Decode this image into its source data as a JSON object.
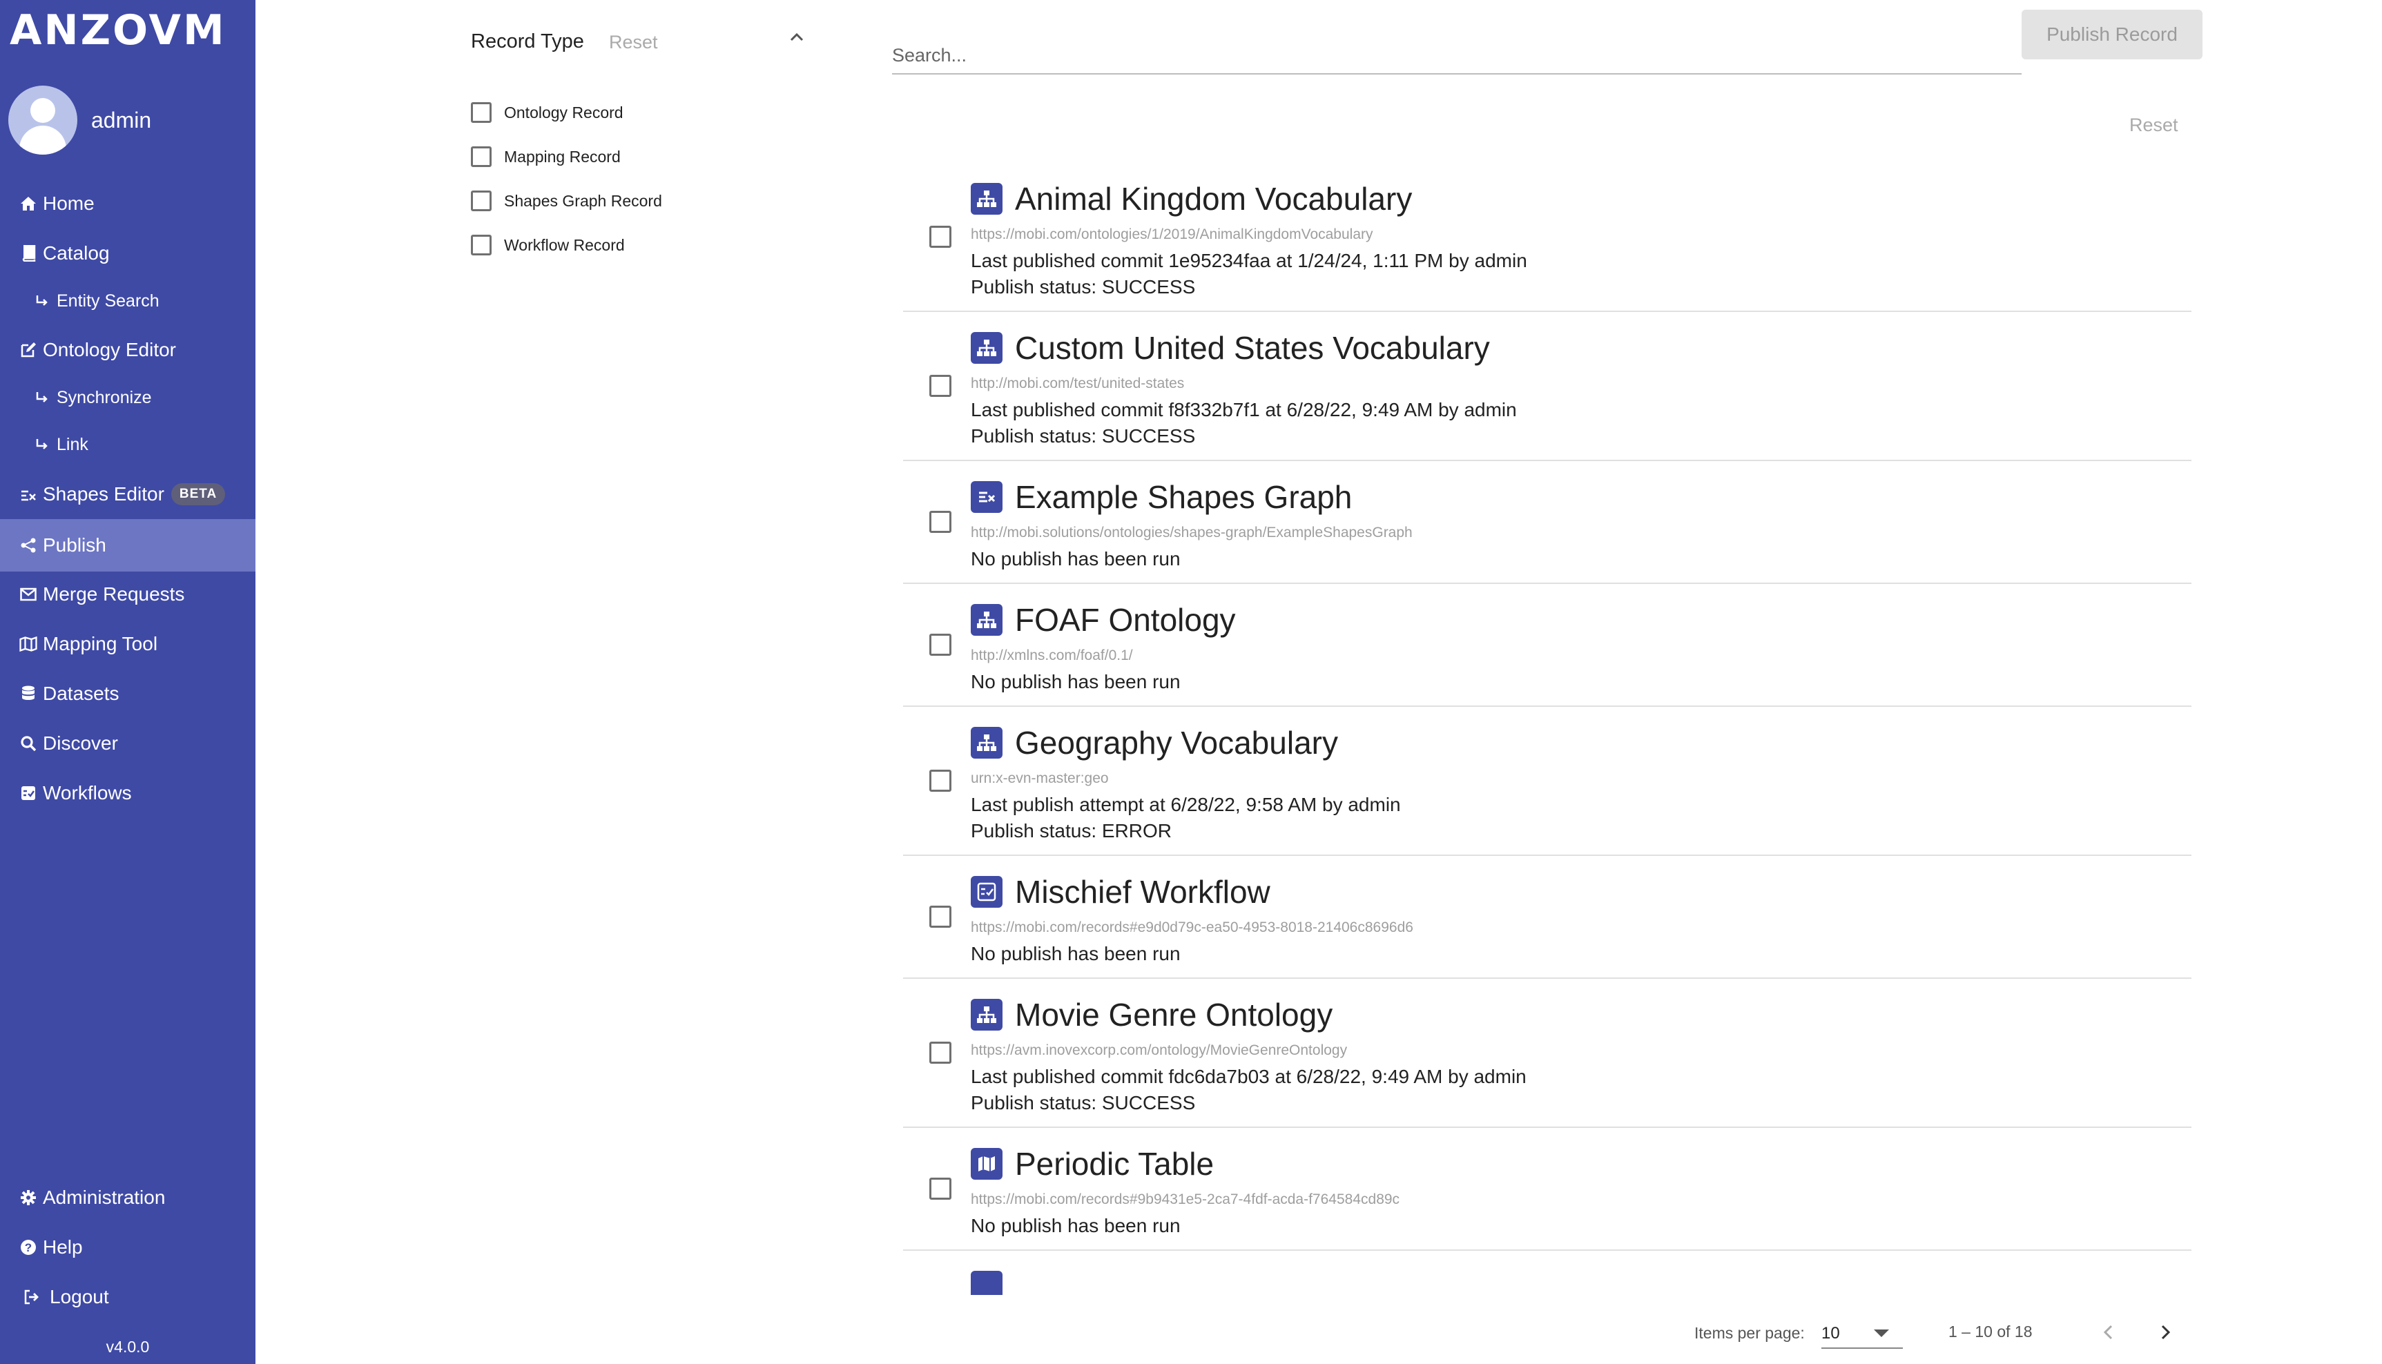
{
  "app": {
    "logo": "ANZOVM",
    "version": "v4.0.0"
  },
  "user": {
    "name": "admin"
  },
  "nav": {
    "home": "Home",
    "catalog": "Catalog",
    "entity_search": "Entity Search",
    "ontology_editor": "Ontology Editor",
    "synchronize": "Synchronize",
    "link": "Link",
    "shapes_editor": "Shapes Editor",
    "beta": "BETA",
    "publish": "Publish",
    "merge_requests": "Merge Requests",
    "mapping_tool": "Mapping Tool",
    "datasets": "Datasets",
    "discover": "Discover",
    "workflows": "Workflows",
    "administration": "Administration",
    "help": "Help",
    "logout": "Logout"
  },
  "filter": {
    "title": "Record Type",
    "reset": "Reset",
    "options": [
      "Ontology Record",
      "Mapping Record",
      "Shapes Graph Record",
      "Workflow Record"
    ]
  },
  "search": {
    "placeholder": "Search..."
  },
  "toolbar": {
    "publish_label": "Publish Record",
    "reset_label": "Reset"
  },
  "records": [
    {
      "title": "Animal Kingdom Vocabulary",
      "icon": "ontology-icon",
      "iri": "https://mobi.com/ontologies/1/2019/AnimalKingdomVocabulary",
      "line1_prefix": "Last published commit ",
      "line1_value": "1e95234faa",
      "line1_mid": " at 1/24/24, 1:11 PM by ",
      "line1_user": "admin",
      "status": "Publish status: SUCCESS"
    },
    {
      "title": "Custom United States Vocabulary",
      "icon": "ontology-icon",
      "iri": "http://mobi.com/test/united-states",
      "line1_prefix": "Last published commit ",
      "line1_value": "f8f332b7f1",
      "line1_mid": " at 6/28/22, 9:49 AM by ",
      "line1_user": "admin",
      "status": "Publish status: SUCCESS"
    },
    {
      "title": "Example Shapes Graph",
      "icon": "shapes-graph-icon",
      "iri": "http://mobi.solutions/ontologies/shapes-graph/ExampleShapesGraph",
      "line1": "No publish has been run"
    },
    {
      "title": "FOAF Ontology",
      "icon": "ontology-icon",
      "iri": "http://xmlns.com/foaf/0.1/",
      "line1": "No publish has been run"
    },
    {
      "title": "Geography Vocabulary",
      "icon": "ontology-icon",
      "iri": "urn:x-evn-master:geo",
      "line1_prefix": "Last publish attempt at 6/28/22, 9:58 AM by ",
      "line1_user": "admin",
      "status": "Publish status: ERROR"
    },
    {
      "title": "Mischief Workflow",
      "icon": "workflow-icon",
      "iri": "https://mobi.com/records#e9d0d79c-ea50-4953-8018-21406c8696d6",
      "line1": "No publish has been run"
    },
    {
      "title": "Movie Genre Ontology",
      "icon": "ontology-icon",
      "iri": "https://avm.inovexcorp.com/ontology/MovieGenreOntology",
      "line1_prefix": "Last published commit ",
      "line1_value": "fdc6da7b03",
      "line1_mid": " at 6/28/22, 9:49 AM by ",
      "line1_user": "admin",
      "status": "Publish status: SUCCESS"
    },
    {
      "title": "Periodic Table",
      "icon": "mapping-icon",
      "iri": "https://mobi.com/records#9b9431e5-2ca7-4fdf-acda-f764584cd89c",
      "line1": "No publish has been run"
    }
  ],
  "paginator": {
    "label": "Items per page:",
    "page_size": "10",
    "range": "1 – 10 of 18"
  }
}
